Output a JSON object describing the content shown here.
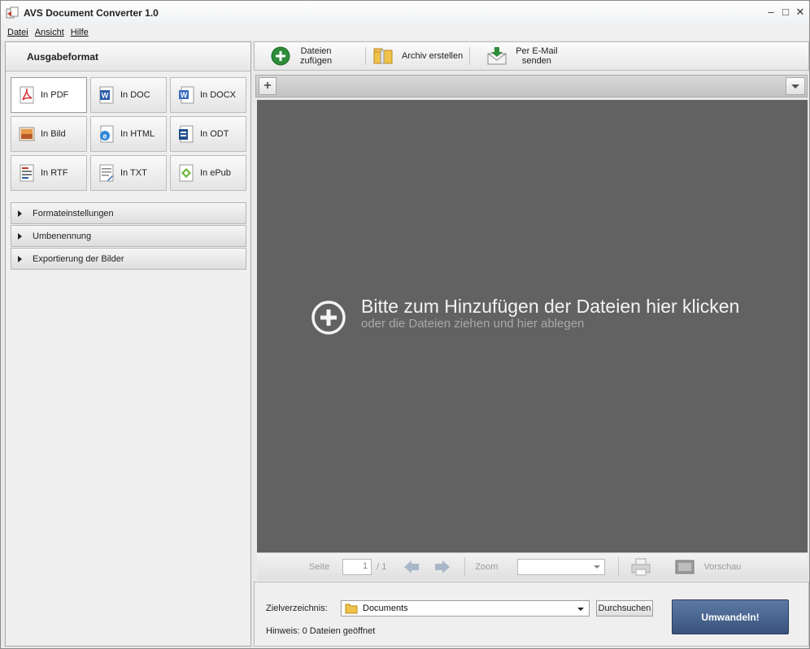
{
  "window": {
    "title": "AVS Document Converter 1.0"
  },
  "menu": {
    "items": [
      "Datei",
      "Ansicht",
      "Hilfe"
    ]
  },
  "left_panel": {
    "header": "Ausgabeformat",
    "formats": [
      {
        "label": "In PDF",
        "icon": "pdf-icon"
      },
      {
        "label": "In DOC",
        "icon": "doc-icon"
      },
      {
        "label": "In DOCX",
        "icon": "docx-icon"
      },
      {
        "label": "In Bild",
        "icon": "image-icon"
      },
      {
        "label": "In HTML",
        "icon": "html-icon"
      },
      {
        "label": "In ODT",
        "icon": "odt-icon"
      },
      {
        "label": "In RTF",
        "icon": "rtf-icon"
      },
      {
        "label": "In TXT",
        "icon": "txt-icon"
      },
      {
        "label": "In ePub",
        "icon": "epub-icon"
      }
    ],
    "sections": [
      "Formateinstellungen",
      "Umbenennung",
      "Exportierung der Bilder"
    ]
  },
  "toolbar": {
    "add_files_l1": "Dateien",
    "add_files_l2": "zufügen",
    "archive": "Archiv erstellen",
    "email_l1": "Per E-Mail",
    "email_l2": "senden"
  },
  "drop_area": {
    "primary": "Bitte zum Hinzufügen der Dateien hier klicken",
    "secondary": "oder die Dateien ziehen und hier ablegen"
  },
  "viewer": {
    "page_label": "Seite",
    "page_value": "1",
    "page_total": "/ 1",
    "zoom_label": "Zoom",
    "zoom_value": "",
    "preview_label": "Vorschau"
  },
  "bottom": {
    "target_label": "Zielverzeichnis:",
    "target_value": "Documents",
    "browse": "Durchsuchen",
    "hint": "Hinweis: 0 Dateien geöffnet",
    "convert": "Umwandeln!"
  },
  "colors": {
    "drop_bg": "#626262",
    "convert_button": "#4a6590",
    "add_green": "#2e8b3a"
  }
}
